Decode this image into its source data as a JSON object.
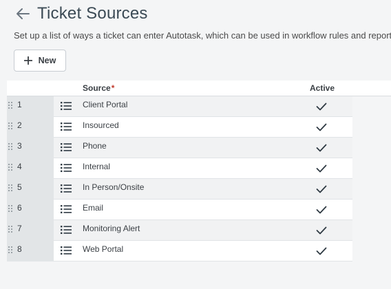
{
  "header": {
    "title": "Ticket Sources",
    "subtitle": "Set up a list of ways a ticket can enter Autotask, which can be used in workflow rules and reports."
  },
  "toolbar": {
    "new_label": "New"
  },
  "grid": {
    "columns": {
      "source": "Source",
      "required_mark": "*",
      "active": "Active"
    },
    "rows": [
      {
        "num": "1",
        "source": "Client Portal",
        "active": true
      },
      {
        "num": "2",
        "source": "Insourced",
        "active": true
      },
      {
        "num": "3",
        "source": "Phone",
        "active": true
      },
      {
        "num": "4",
        "source": "Internal",
        "active": true
      },
      {
        "num": "5",
        "source": "In Person/Onsite",
        "active": true
      },
      {
        "num": "6",
        "source": "Email",
        "active": true
      },
      {
        "num": "7",
        "source": "Monitoring Alert",
        "active": true
      },
      {
        "num": "8",
        "source": "Web Portal",
        "active": true
      }
    ]
  },
  "icons": {
    "back": "arrow-left-icon",
    "new": "plus-icon",
    "row_menu": "list-menu-icon",
    "active": "checkmark-icon",
    "drag": "drag-handle-icon"
  },
  "colors": {
    "title": "#3b4a55",
    "required": "#c0392b",
    "row_number_bg": "#e2e5e7",
    "odd_row_bg": "#f1f2f3",
    "even_row_bg": "#ffffff"
  }
}
